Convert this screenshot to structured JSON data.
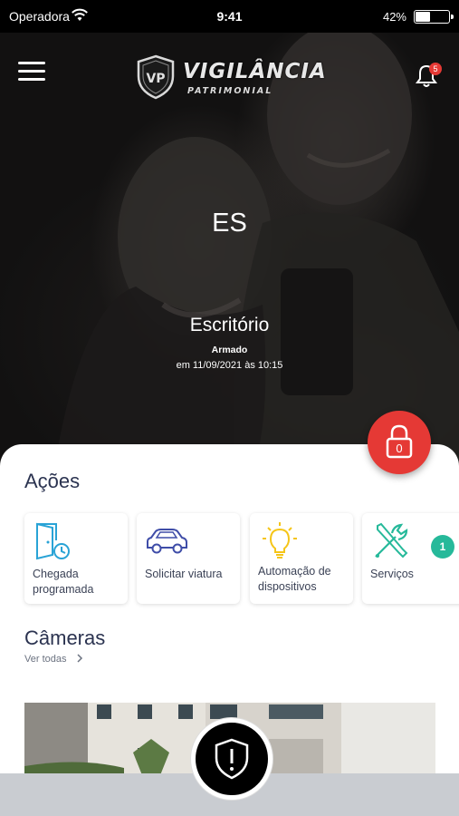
{
  "status_bar": {
    "carrier": "Operadora",
    "time": "9:41",
    "battery": "42%",
    "battery_level": 0.42
  },
  "header": {
    "logo_title": "VIGILÂNCIA",
    "logo_subtitle": "PATRIMONIAL",
    "notification_count": "5"
  },
  "location": {
    "initials": "ES",
    "name": "Escritório",
    "status": "Armado",
    "status_date": "em 11/09/2021 às 10:15"
  },
  "lock_button": {
    "count": "0"
  },
  "actions": {
    "title": "Ações",
    "items": [
      {
        "label": "Chegada programada",
        "icon": "door-clock-icon"
      },
      {
        "label": "Solicitar viatura",
        "icon": "car-icon"
      },
      {
        "label": "Automação de dispositivos",
        "icon": "lightbulb-icon"
      },
      {
        "label": "Serviços",
        "icon": "tools-icon"
      }
    ],
    "services_badge": "1"
  },
  "cameras": {
    "title": "Câmeras",
    "see_all": "Ver todas"
  },
  "colors": {
    "accent_red": "#e53935",
    "badge_green": "#26b99a",
    "icon_blue": "#29a3d6",
    "icon_navy": "#3f4da8",
    "icon_yellow": "#f5c518",
    "icon_teal": "#26b99a",
    "heading": "#2b3350"
  }
}
